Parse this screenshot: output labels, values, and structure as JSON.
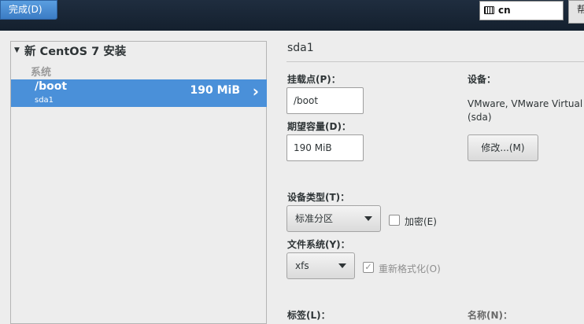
{
  "topbar": {
    "done_label": "完成(D)",
    "keyboard_layout": "cn",
    "help_label": "帮"
  },
  "tree": {
    "root_label": "新 CentOS 7 安装",
    "group_label": "系统",
    "selected": {
      "mount": "/boot",
      "device": "sda1",
      "size": "190 MiB"
    }
  },
  "detail": {
    "title": "sda1",
    "mount_point_label": "挂载点(P)：",
    "mount_point_value": "/boot",
    "capacity_label": "期望容量(D)：",
    "capacity_value": "190 MiB",
    "device_label": "设备：",
    "device_value": "VMware, VMware Virtual (sda)",
    "modify_label": "修改...(M)",
    "device_type_label": "设备类型(T)：",
    "device_type_value": "标准分区",
    "encrypt_label": "加密(E)",
    "filesystem_label": "文件系统(Y)：",
    "filesystem_value": "xfs",
    "reformat_label": "重新格式化(O)",
    "tag_label": "标签(L)：",
    "name_label": "名称(N)："
  }
}
